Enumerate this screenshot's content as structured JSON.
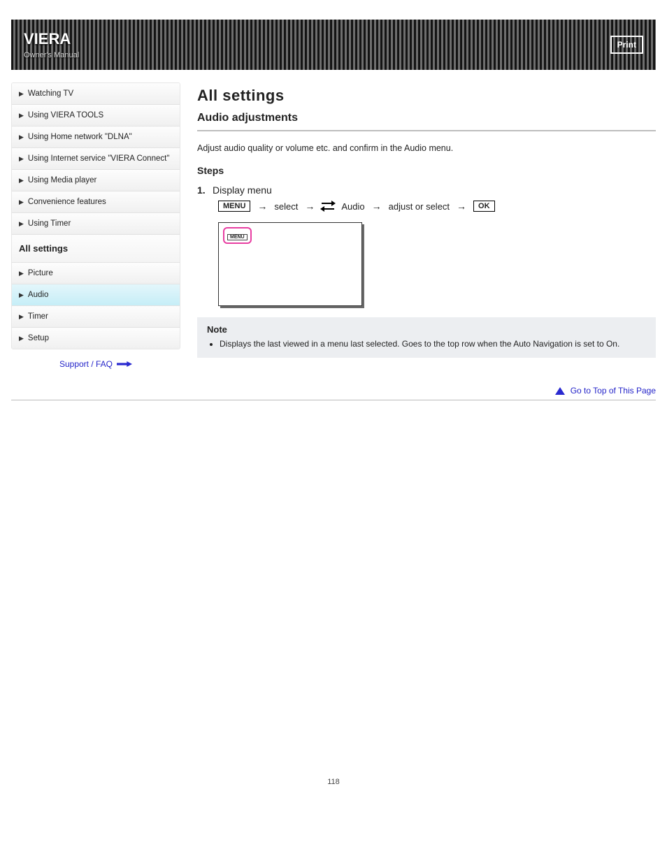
{
  "header": {
    "brand": "VIERA",
    "subtitle": "Owner's Manual",
    "print_label": "Print"
  },
  "sidebar": {
    "items": [
      {
        "label": "Watching TV",
        "active": false
      },
      {
        "label": "Using VIERA TOOLS",
        "active": false
      },
      {
        "label": "Using Home network \"DLNA\"",
        "active": false
      },
      {
        "label": "Using Internet service \"VIERA Connect\"",
        "active": false
      },
      {
        "label": "Using Media player",
        "active": false
      },
      {
        "label": "Convenience features",
        "active": false
      },
      {
        "label": "Using Timer",
        "active": false
      }
    ],
    "owner_header": "All settings",
    "sub_items": [
      {
        "label": "Picture",
        "active": false
      },
      {
        "label": "Audio",
        "active": true
      },
      {
        "label": "Timer",
        "active": false
      },
      {
        "label": "Setup",
        "active": false
      }
    ],
    "next_label": "Support / FAQ"
  },
  "main": {
    "title": "All settings",
    "subtitle": "Audio adjustments",
    "intro": "Adjust audio quality or volume etc. and confirm in the Audio menu.",
    "steps_heading": "Steps",
    "step_no": "1.",
    "step_segments": {
      "display_menu": "Display menu",
      "menu_btn": "MENU",
      "select": "select",
      "audio": "Audio",
      "adjust_or_select": "adjust or select",
      "ok_btn": "OK"
    },
    "mock_menu": "MENU",
    "note_title": "Note",
    "note_items": [
      "Displays the last viewed in a menu last selected. Goes to the top row when the Auto Navigation is set to On."
    ],
    "go_top": "Go to Top of This Page"
  },
  "page_number": "118"
}
